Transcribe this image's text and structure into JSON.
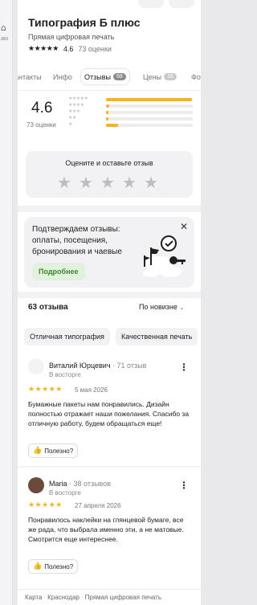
{
  "business": {
    "name": "Типография Б плюс",
    "category": "Прямая цифровая печать",
    "rating_stars": "★★★★★",
    "rating": "4.6",
    "ratings_count": "73 оценки"
  },
  "side": {
    "icon": "home-icon",
    "label": "аю"
  },
  "tabs": [
    {
      "label": "антакты"
    },
    {
      "label": "Инфо"
    },
    {
      "label": "Отзывы",
      "badge": "68"
    },
    {
      "label": "Цены",
      "badge": "18"
    },
    {
      "label": "Фо"
    }
  ],
  "summary": {
    "rating": "4.6",
    "count": "73 оценки",
    "histogram": [
      {
        "stars": "★★★★★",
        "share": 0.99
      },
      {
        "stars": "★★★★",
        "share": 0.04
      },
      {
        "stars": "★★★",
        "share": 0.03
      },
      {
        "stars": "★★",
        "share": 0.03
      },
      {
        "stars": "★",
        "share": 0.14
      }
    ]
  },
  "rate_box": {
    "title": "Оцените и оставьте отзыв",
    "star": "★"
  },
  "promo": {
    "text": "Подтверждаем отзывы: оплаты, посещения, бронирования и чаевые",
    "button": "Подробнее",
    "close": "✕"
  },
  "reviews_header": {
    "title": "63 отзыва",
    "sort": "По новизне",
    "chevron": "⌄"
  },
  "chips": [
    "Отличная типография",
    "Качественная печать"
  ],
  "reviews": [
    {
      "author": "Виталий Юрцевич",
      "author_reviews": "71 отзыв",
      "level": "В восторге",
      "stars": "★★★★★",
      "date": "5 мая 2026",
      "text": "Бумажные пакеты нам понравились. Дизайн полностью отражает наши пожелания. Спасибо за отличную работу, будем обращаться еще!",
      "helpful": "Полезно?"
    },
    {
      "author": "Мaria",
      "author_reviews": "38 отзывов",
      "level": "В восторге",
      "stars": "★★★★★",
      "date": "27 апреля 2026",
      "text": "Понравилось наклейки на глянцевой бумаге, все же рада, что выбрала именно эти, а не матовые. Смотрится еще интереснее.",
      "helpful": "Полезно?"
    }
  ],
  "more_icon": "⋮",
  "thumb_icon": "👍",
  "footer": {
    "items": [
      "Карта",
      "Краснодар",
      "Прямая цифровая печать"
    ],
    "sep": "·"
  },
  "colors": {
    "accent_star": "#f8b31b",
    "promo_button": "#3a8a2b"
  }
}
